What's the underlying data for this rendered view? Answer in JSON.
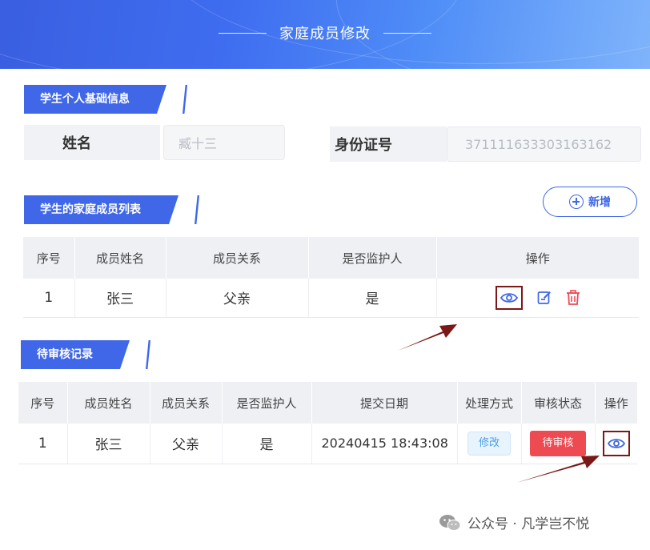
{
  "header": {
    "title": "家庭成员修改"
  },
  "basic_info": {
    "section_title": "学生个人基础信息",
    "name_label": "姓名",
    "name_value": "臧十三",
    "id_label": "身份证号",
    "id_value": "371111633303163162"
  },
  "family_list": {
    "section_title": "学生的家庭成员列表",
    "add_label": "新增",
    "columns": [
      "序号",
      "成员姓名",
      "成员关系",
      "是否监护人",
      "操作"
    ],
    "rows": [
      {
        "index": "1",
        "name": "张三",
        "relation": "父亲",
        "guardian": "是"
      }
    ]
  },
  "pending": {
    "section_title": "待审核记录",
    "columns": [
      "序号",
      "成员姓名",
      "成员关系",
      "是否监护人",
      "提交日期",
      "处理方式",
      "审核状态",
      "操作"
    ],
    "rows": [
      {
        "index": "1",
        "name": "张三",
        "relation": "父亲",
        "guardian": "是",
        "date": "20240415 18:43:08",
        "method": "修改",
        "status": "待审核"
      }
    ]
  },
  "watermark": {
    "text": "公众号 · 凡学岂不悦"
  },
  "icons": {
    "view": "eye-icon",
    "edit": "edit-icon",
    "delete": "trash-icon",
    "add": "plus-circle-icon",
    "wechat": "wechat-icon"
  },
  "colors": {
    "primary": "#3f67e8",
    "danger": "#ee4a52",
    "highlight_box": "#7a1818",
    "arrow": "#7a1818"
  }
}
